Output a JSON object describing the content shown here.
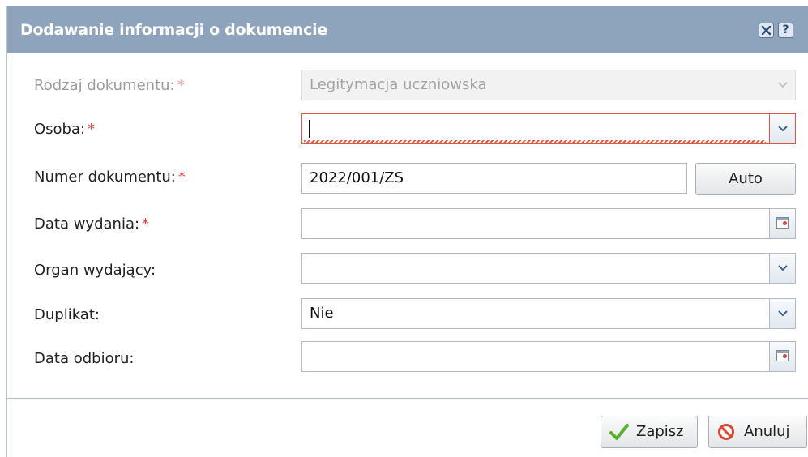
{
  "dialog": {
    "title": "Dodawanie informacji o dokumencie",
    "close_icon": "close-icon",
    "help_icon": "help-icon",
    "help_label": "?"
  },
  "form": {
    "required_mark": "*",
    "document_type": {
      "label": "Rodzaj dokumentu:",
      "value": "Legitymacja uczniowska",
      "disabled": true
    },
    "person": {
      "label": "Osoba:",
      "value": ""
    },
    "document_number": {
      "label": "Numer dokumentu:",
      "value": "2022/001/ZS",
      "auto_label": "Auto"
    },
    "issue_date": {
      "label": "Data wydania:",
      "value": ""
    },
    "issuing_authority": {
      "label": "Organ wydający:",
      "value": ""
    },
    "duplicate": {
      "label": "Duplikat:",
      "value": "Nie"
    },
    "pickup_date": {
      "label": "Data odbioru:",
      "value": ""
    }
  },
  "footer": {
    "save_label": "Zapisz",
    "cancel_label": "Anuluj"
  },
  "colors": {
    "titlebar": "#8ea4bc",
    "required": "#e33b3b",
    "invalid_border": "#d85a46",
    "save_check": "#5bb12f",
    "cancel_icon": "#d9472f"
  }
}
